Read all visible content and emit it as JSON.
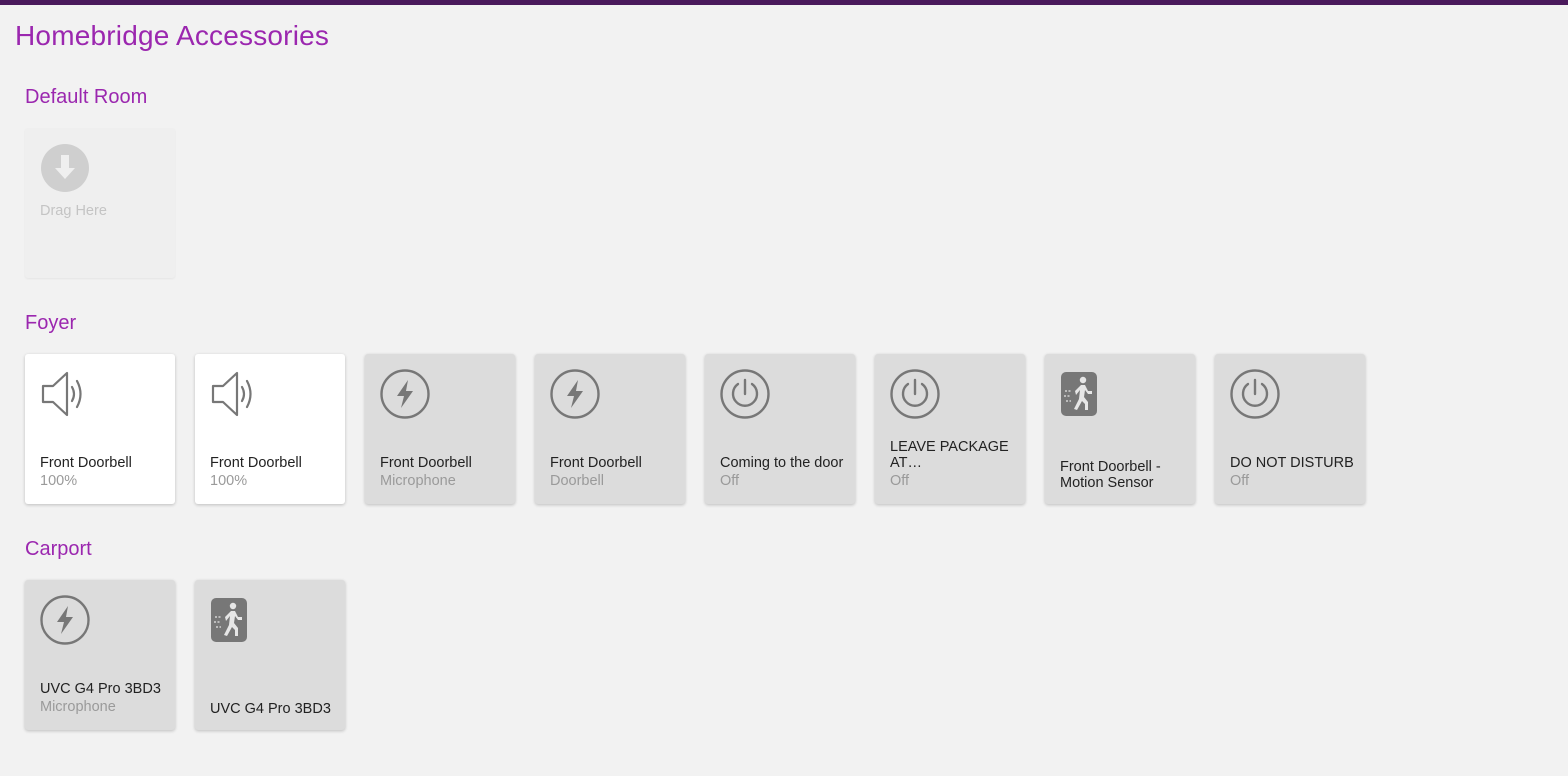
{
  "page": {
    "title": "Homebridge Accessories"
  },
  "colors": {
    "accent": "#9b27af",
    "topbar": "#4a1a5c",
    "tile_on": "#ffffff",
    "tile_off": "#dcdcdc",
    "icon": "#777777"
  },
  "rooms": [
    {
      "name": "Default Room",
      "placeholder": {
        "label": "Drag Here",
        "icon": "arrow-down-circle-icon"
      }
    },
    {
      "name": "Foyer",
      "tiles": [
        {
          "name": "Front Doorbell",
          "status": "100%",
          "icon": "speaker-icon",
          "on": true
        },
        {
          "name": "Front Doorbell",
          "status": "100%",
          "icon": "speaker-icon",
          "on": true
        },
        {
          "name": "Front Doorbell",
          "status": "Microphone",
          "icon": "lightning-icon",
          "on": false
        },
        {
          "name": "Front Doorbell",
          "status": "Doorbell",
          "icon": "lightning-icon",
          "on": false
        },
        {
          "name": "Coming to the door",
          "status": "Off",
          "icon": "power-icon",
          "on": false
        },
        {
          "name": "LEAVE PACKAGE AT…",
          "status": "Off",
          "icon": "power-icon",
          "on": false
        },
        {
          "name": "Front Doorbell - Motion Sensor",
          "status": "",
          "icon": "motion-sensor-icon",
          "on": false
        },
        {
          "name": "DO NOT DISTURB",
          "status": "Off",
          "icon": "power-icon",
          "on": false
        }
      ]
    },
    {
      "name": "Carport",
      "tiles": [
        {
          "name": "UVC G4 Pro 3BD3",
          "status": "Microphone",
          "icon": "lightning-icon",
          "on": false
        },
        {
          "name": "UVC G4 Pro 3BD3",
          "status": "",
          "icon": "motion-sensor-icon",
          "on": false
        }
      ]
    }
  ]
}
